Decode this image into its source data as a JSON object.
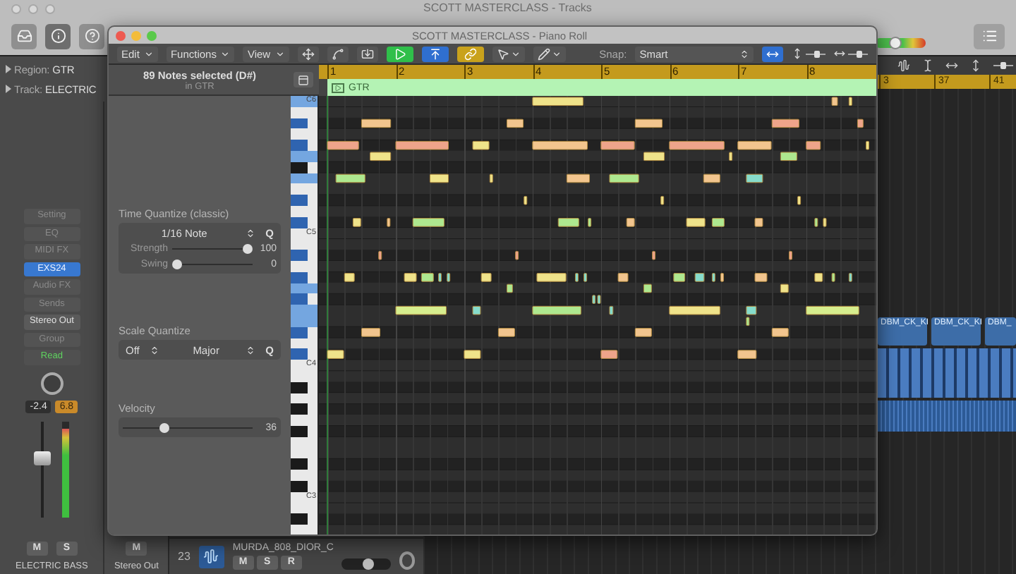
{
  "main_window": {
    "title": "SCOTT MASTERCLASS - Tracks",
    "master_volume": {
      "level": 0.37
    }
  },
  "inspector": {
    "lines": [
      {
        "label": "Region:",
        "value": "GTR"
      },
      {
        "label": "Track:",
        "value": "ELECTRIC"
      }
    ]
  },
  "channel_strip": {
    "slots": [
      {
        "label": "Setting",
        "kind": "slot"
      },
      {
        "label": "EQ",
        "kind": "slot"
      },
      {
        "label": "MIDI FX",
        "kind": "slot"
      },
      {
        "label": "EXS24",
        "kind": "instrument"
      },
      {
        "label": "Audio FX",
        "kind": "slot"
      },
      {
        "label": "Sends",
        "kind": "slot"
      },
      {
        "label": "Stereo Out",
        "kind": "output"
      },
      {
        "label": "Group",
        "kind": "slot"
      },
      {
        "label": "Read",
        "kind": "automation"
      }
    ],
    "readings": [
      {
        "text": "-2.4",
        "kind": "volume"
      },
      {
        "text": "6.8",
        "kind": "peak"
      }
    ],
    "fader": {
      "level": 0.63
    },
    "meter": {
      "level": 0.92
    },
    "buttons": [
      "M",
      "S"
    ],
    "name": "ELECTRIC BASS"
  },
  "output_strip": {
    "buttons": [
      "M"
    ],
    "name": "Stereo Out"
  },
  "piano_roll": {
    "title": "SCOTT MASTERCLASS - Piano Roll",
    "menus": [
      "Edit",
      "Functions",
      "View"
    ],
    "toggles": [
      {
        "kind": "midi-out",
        "on": true
      },
      {
        "kind": "flex",
        "on": true
      },
      {
        "kind": "link",
        "on": true
      }
    ],
    "snap": {
      "label": "Snap:",
      "value": "Smart",
      "align_on": true
    },
    "zoom": {
      "vertical": {
        "level": 0.55
      },
      "horizontal": {
        "level": 0.6
      }
    },
    "selection": {
      "title": "89 Notes selected (D#)",
      "subtitle": "in GTR"
    },
    "time_quantize": {
      "label": "Time Quantize (classic)",
      "value": "1/16 Note",
      "button": "Q",
      "strength": {
        "label": "Strength",
        "level": 1,
        "reading": "100"
      },
      "swing": {
        "label": "Swing",
        "level": 0,
        "reading": "0"
      }
    },
    "scale_quantize": {
      "label": "Scale Quantize",
      "mode": "Off",
      "scale": "Major",
      "button": "Q"
    },
    "velocity": {
      "label": "Velocity",
      "level": 0.3,
      "reading": "36"
    },
    "ruler": [
      "1",
      "2",
      "3",
      "4",
      "5",
      "6",
      "7",
      "8"
    ],
    "region": "GTR",
    "keys": [
      "C6",
      "C5",
      "C4",
      "C3"
    ]
  },
  "tracks": {
    "zoom": {
      "level": 0.5
    },
    "ruler": [
      "3",
      "37",
      "41"
    ],
    "regions": [
      "DBM_CK_KI",
      "DBM_CK_KI",
      "DBM_"
    ]
  },
  "track_header": {
    "number": "23",
    "name": "MURDA_808_DIOR_C",
    "buttons": [
      "M",
      "S",
      "R"
    ],
    "volume": {
      "level": 0.55
    }
  }
}
